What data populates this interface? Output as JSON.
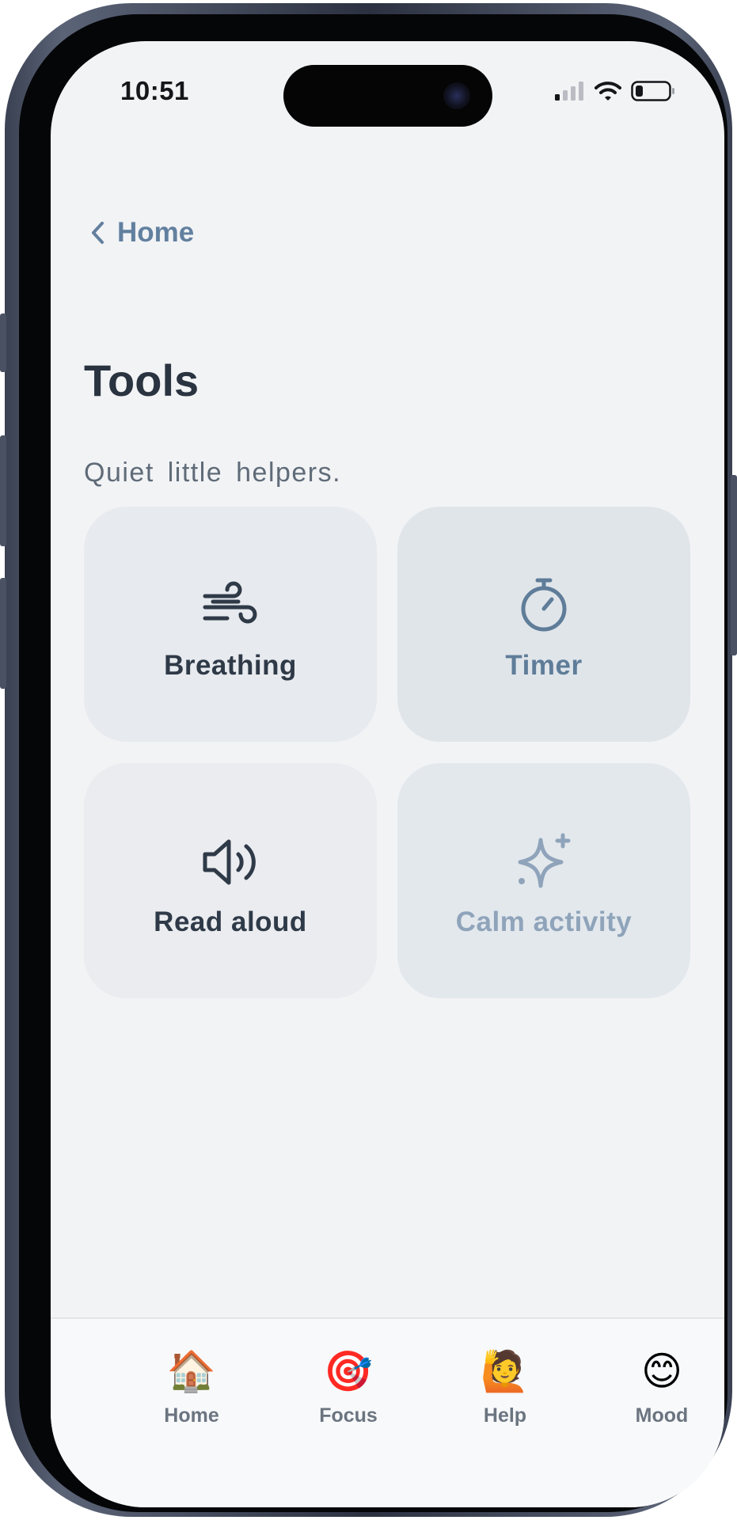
{
  "status_bar": {
    "time": "10:51",
    "icons": [
      "cellular-signal-icon",
      "wifi-icon",
      "battery-icon"
    ]
  },
  "nav": {
    "back_label": "Home"
  },
  "page": {
    "title": "Tools",
    "subtitle": "Quiet little helpers."
  },
  "tools": [
    {
      "label": "Breathing",
      "icon": "wind-icon",
      "color": "#2f3a48"
    },
    {
      "label": "Timer",
      "icon": "stopwatch-icon",
      "color": "#5f7d99"
    },
    {
      "label": "Read aloud",
      "icon": "speaker-icon",
      "color": "#2f3a48"
    },
    {
      "label": "Calm activity",
      "icon": "sparkle-icon",
      "color": "#8fa4ba"
    }
  ],
  "tab_bar": {
    "items": [
      {
        "label": "Home",
        "emoji": "🏠",
        "icon": "house-icon"
      },
      {
        "label": "Focus",
        "emoji": "🎯",
        "icon": "target-icon"
      },
      {
        "label": "Help",
        "emoji": "🙋",
        "icon": "raised-hand-icon"
      },
      {
        "label": "Mood",
        "emoji": "😊",
        "icon": "smiley-icon"
      }
    ]
  },
  "colors": {
    "background": "#f2f3f5",
    "title": "#2a3340",
    "link": "#62809f",
    "tabbar": "#f8f9fa"
  }
}
